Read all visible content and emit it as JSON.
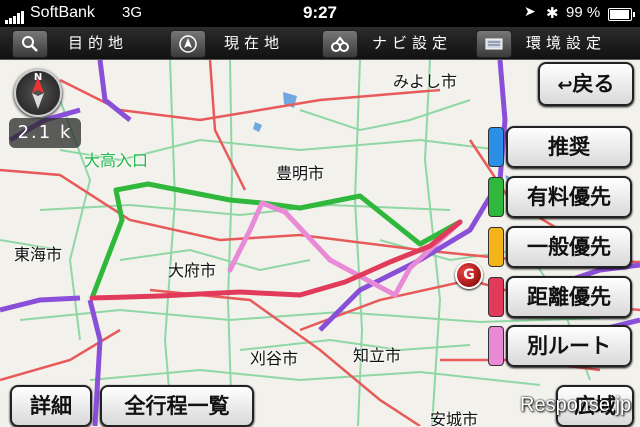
{
  "status_bar": {
    "carrier": "SoftBank",
    "network": "3G",
    "time": "9:27",
    "battery": "99 %",
    "icons": [
      "signal-icon",
      "location-arrow-icon",
      "bluetooth-icon",
      "battery-icon"
    ]
  },
  "menu": {
    "destination": "目的地",
    "current_location": "現在地",
    "navi_settings": "ナビ設定",
    "environment_settings": "環境設定"
  },
  "map": {
    "scale": "2.1 k",
    "compass_label": "N",
    "goal_label": "G",
    "places": {
      "miyoshi": "みよし市",
      "toyoake": "豊明市",
      "tokai": "東海市",
      "obu": "大府市",
      "kariya": "刈谷市",
      "chiryu": "知立市",
      "anjo": "安城市",
      "otaka_iriguchi": "大高入口"
    }
  },
  "buttons": {
    "back": "戻る",
    "details": "詳細",
    "full_route_list": "全行程一覧",
    "wide_area": "広域"
  },
  "route_options": [
    {
      "label": "推奨",
      "color": "#2b8fe6"
    },
    {
      "label": "有料優先",
      "color": "#2fb83c"
    },
    {
      "label": "一般優先",
      "color": "#f2b418"
    },
    {
      "label": "距離優先",
      "color": "#e23a5a"
    },
    {
      "label": "別ルート",
      "color": "#e88ad6"
    }
  ],
  "watermark": "Response.jp"
}
